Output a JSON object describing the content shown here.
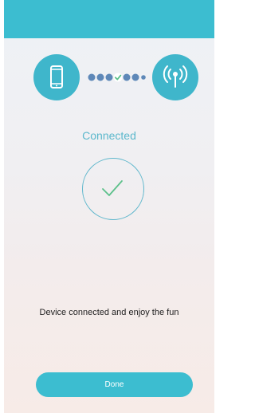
{
  "colors": {
    "accent": "#3cbdd0",
    "circle": "#3fb6cb",
    "dot": "#5e88b8",
    "status_text": "#5bb8cc",
    "check": "#5cc08a"
  },
  "pairing": {
    "left_icon": "phone-icon",
    "right_icon": "antenna-icon",
    "connector_icon": "check-icon"
  },
  "status": {
    "title": "Connected"
  },
  "message": "Device connected and enjoy the fun",
  "done_button": {
    "label": "Done"
  }
}
